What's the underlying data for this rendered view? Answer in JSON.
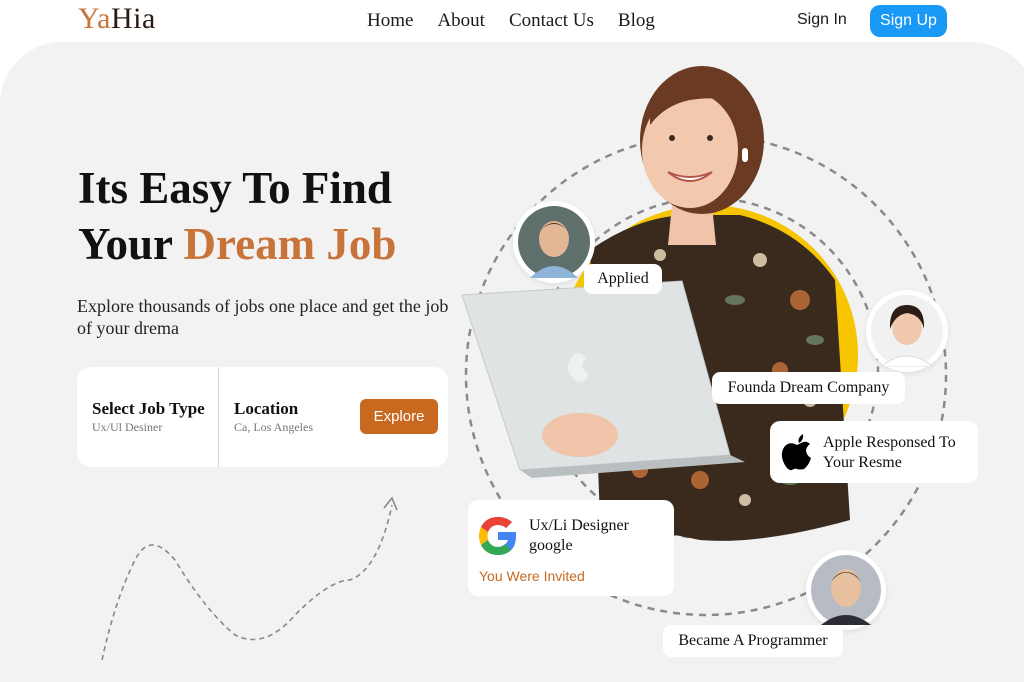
{
  "brand": {
    "part1": "Ya",
    "part2": "Hia"
  },
  "nav": {
    "items": [
      "Home",
      "About",
      "Contact Us",
      "Blog"
    ]
  },
  "auth": {
    "signin": "Sign In",
    "signup": "Sign Up"
  },
  "hero": {
    "headline_line1": "Its Easy To Find",
    "headline_line2_plain": "Your ",
    "headline_line2_accent": "Dream Job",
    "subtitle": "Explore thousands of jobs one place and get the job of your drema"
  },
  "search": {
    "job_type_label": "Select Job Type",
    "job_type_value": "Ux/Ul Desiner",
    "location_label": "Location",
    "location_value": "Ca, Los Angeles",
    "button": "Explore"
  },
  "tags": {
    "applied": "Applied",
    "founda": "Founda Dream Company",
    "apple_line1": "Apple Responsed To",
    "apple_line2": "Your Resme",
    "job_title": "Ux/Li Designer",
    "job_company": "google",
    "invited": "You Were Invited",
    "programmer": "Became A Programmer"
  },
  "colors": {
    "accent": "#c8733a",
    "signup": "#1a98f5",
    "explore": "#c9691f",
    "panel": "#f2f2f2"
  },
  "icons": [
    "apple-icon",
    "google-icon",
    "arrow-icon"
  ]
}
